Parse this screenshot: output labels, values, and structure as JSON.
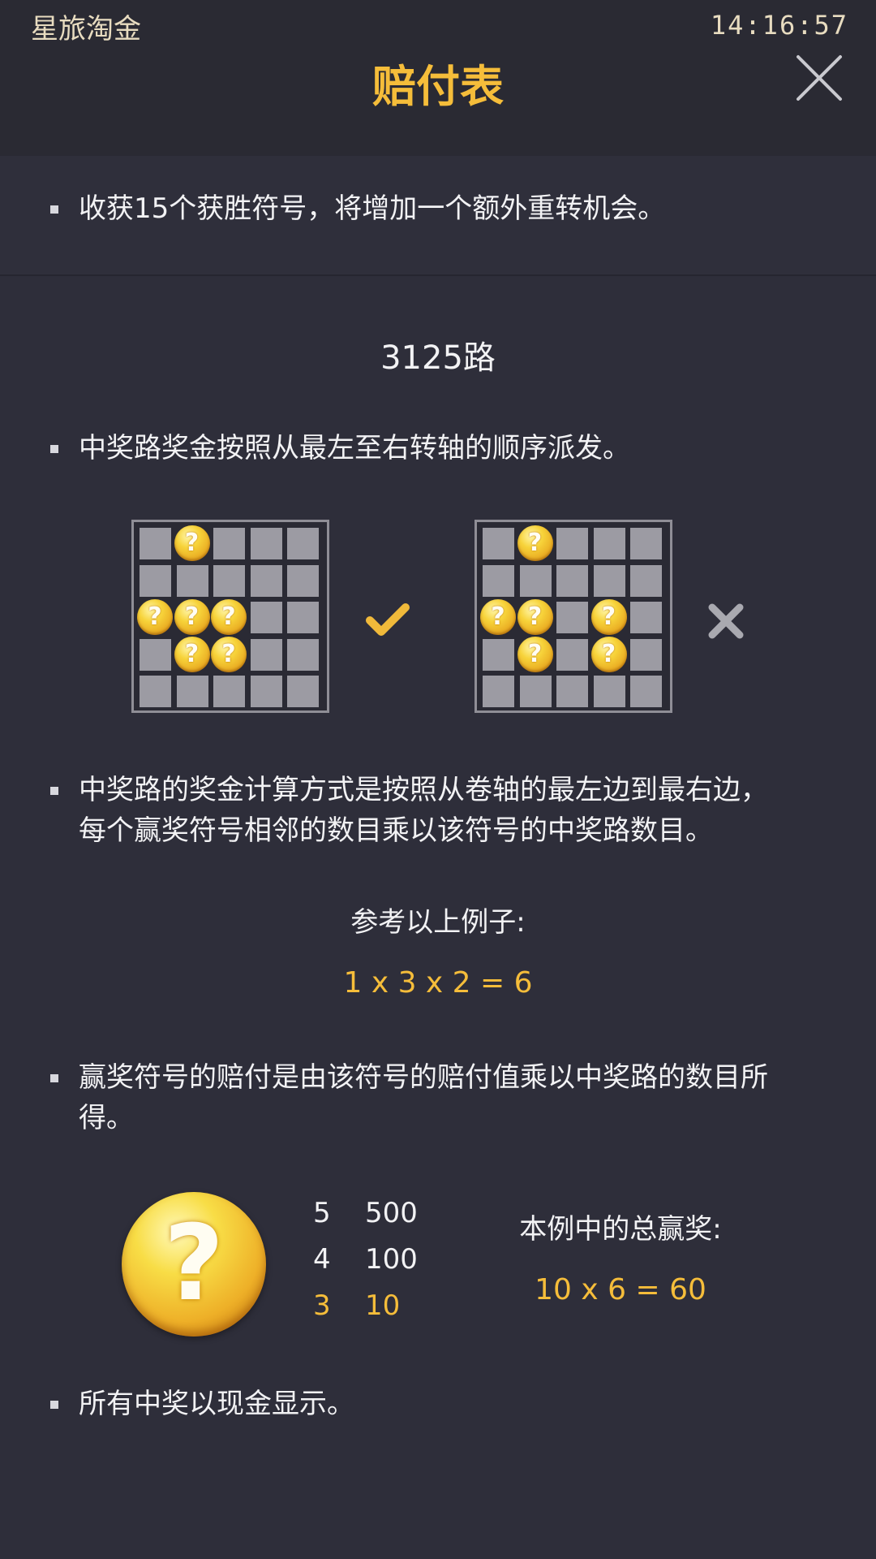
{
  "status": {
    "app_name": "星旅淘金",
    "time": "14:16:57"
  },
  "header": {
    "title": "赔付表"
  },
  "notes": {
    "respin": "收获15个获胜符号，将增加一个额外重转机会。"
  },
  "ways": {
    "heading": "3125路",
    "rule_order": "中奖路奖金按照从最左至右转轴的顺序派发。",
    "rule_calc_line1": "中奖路的奖金计算方式是按照从卷轴的最左边到最右边，",
    "rule_calc_line2": "每个赢奖符号相邻的数目乘以该符号的中奖路数目。",
    "example_label": "参考以上例子:",
    "example_formula": "1 x 3 x 2 = 6",
    "rule_payout_line1": "赢奖符号的赔付是由该符号的赔付值乘以中奖路的数目所",
    "rule_payout_line2": "得。"
  },
  "examples": {
    "coin_glyph": "?",
    "valid_mark": "✔",
    "invalid_mark": "✖"
  },
  "paytable": {
    "symbol_icon": "question-coin-icon",
    "rows": [
      {
        "count": "5",
        "value": "500"
      },
      {
        "count": "4",
        "value": "100"
      },
      {
        "count": "3",
        "value": "10"
      }
    ],
    "total_label": "本例中的总赢奖:",
    "total_formula": "10 x 6 = 60"
  },
  "footer_note": "所有中奖以现金显示。",
  "colors": {
    "accent": "#f5bd3a",
    "background": "#2e2e3a",
    "header": "#2a2a33"
  }
}
